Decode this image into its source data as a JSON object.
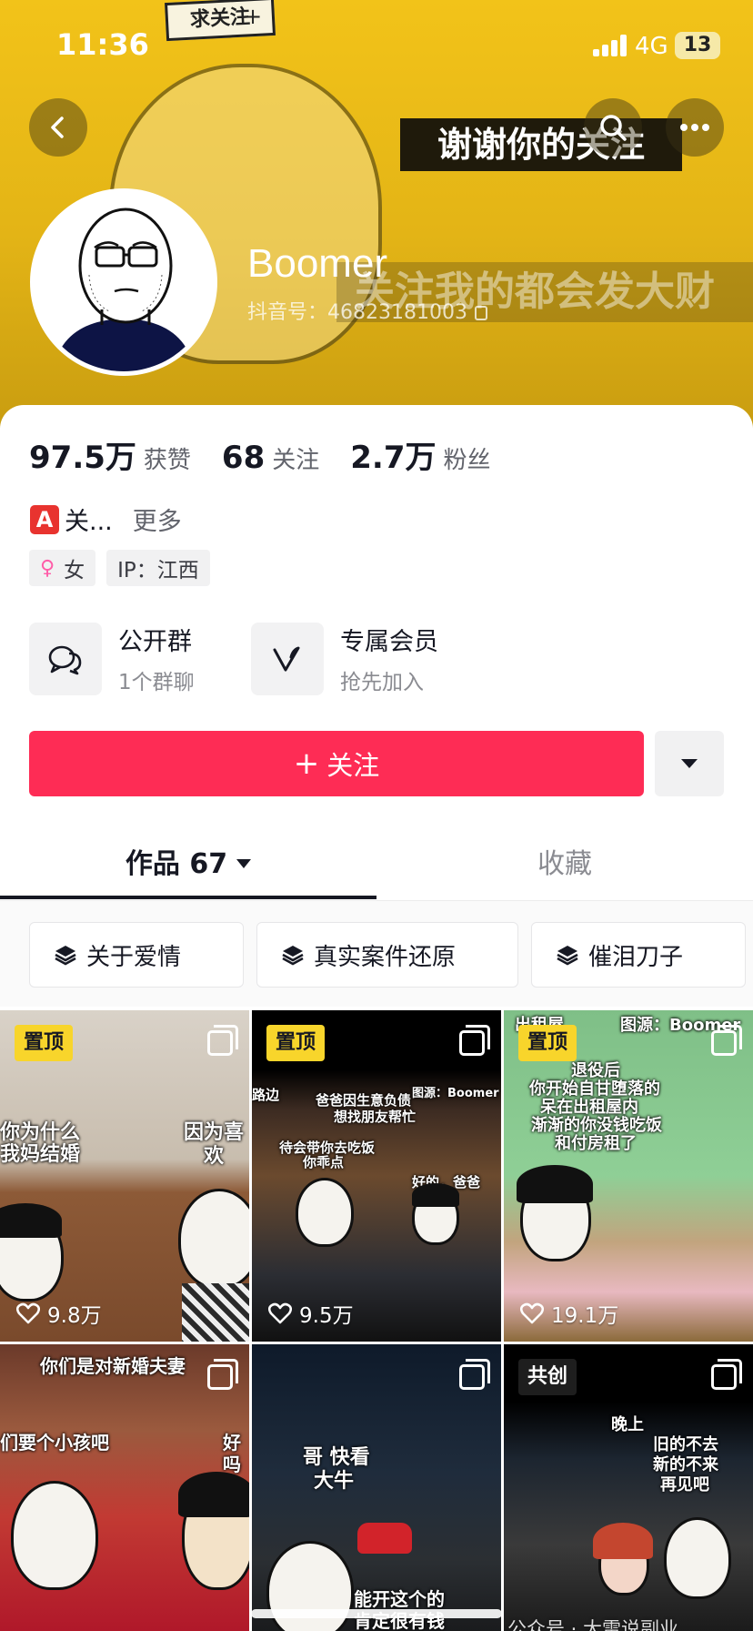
{
  "status_bar": {
    "time": "11:36",
    "network": "4G",
    "battery": "13"
  },
  "banner": {
    "sign_text": "求关注",
    "caption_top": "谢谢你的关注",
    "caption_bottom": "关注我的都会发大财"
  },
  "profile": {
    "name": "Boomer",
    "douyin_id": "抖音号：46823181003"
  },
  "stats": [
    {
      "value": "97.5万",
      "label": "获赞"
    },
    {
      "value": "68",
      "label": "关注"
    },
    {
      "value": "2.7万",
      "label": "粉丝"
    }
  ],
  "bio": {
    "badge": "A",
    "text": "关...",
    "more": "更多"
  },
  "tags": {
    "gender": "女",
    "ip": "IP：江西"
  },
  "groups": [
    {
      "title": "公开群",
      "subtitle": "1个群聊",
      "icon": "chat-bubbles-icon"
    },
    {
      "title": "专属会员",
      "subtitle": "抢先加入",
      "icon": "v-member-icon"
    }
  ],
  "actions": {
    "follow_label": "关注",
    "follow_color": "#fe2c55"
  },
  "tabs": {
    "works_label": "作品 67",
    "collect_label": "收藏"
  },
  "collections": [
    "关于爱情",
    "真实案件还原",
    "催泪刀子"
  ],
  "videos": [
    {
      "badge": "置顶",
      "likes": "9.8万",
      "captions": [
        "你为什么",
        "我妈结婚",
        "因为喜欢"
      ]
    },
    {
      "badge": "置顶",
      "likes": "9.5万",
      "captions": [
        "爸爸因生意负债",
        "想找朋友帮忙",
        "待会带你去吃饭",
        "你乖点",
        "好的，爸爸",
        "路边",
        "图源：Boomer"
      ]
    },
    {
      "badge": "置顶",
      "likes": "19.1万",
      "captions": [
        "退役后",
        "你开始自甘堕落的",
        "呆在出租屋内",
        "渐渐的你没钱吃饭",
        "和付房租了",
        "出租屋",
        "图源：Boomer"
      ]
    },
    {
      "badge": "",
      "likes": "",
      "captions": [
        "你们是对新婚夫妻",
        "们要个小孩吧",
        "好吗"
      ]
    },
    {
      "badge": "",
      "likes": "",
      "captions": [
        "哥 快看",
        "大牛",
        "能开这个的",
        "肯定很有钱"
      ]
    },
    {
      "badge": "共创",
      "likes": "",
      "captions": [
        "晚上",
        "旧的不去",
        "新的不来",
        "再见吧"
      ]
    }
  ],
  "watermark": "公众号 · 大雷说副业"
}
